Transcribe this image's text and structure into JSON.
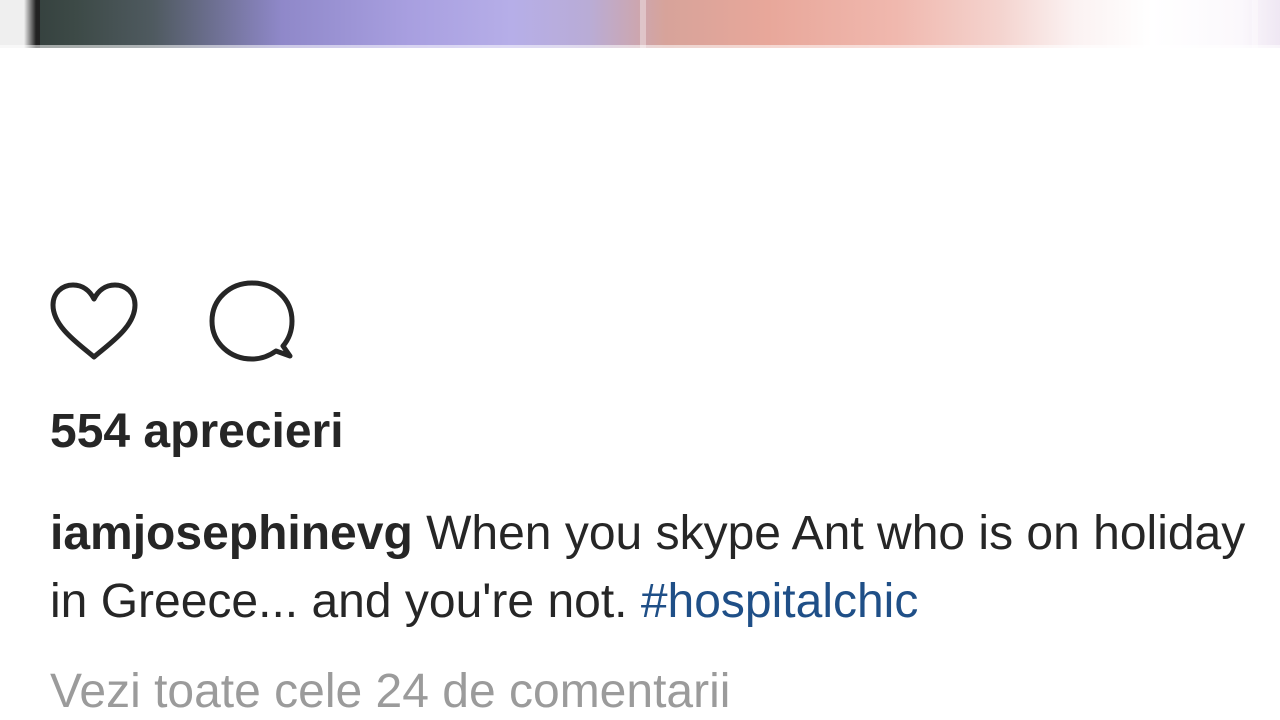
{
  "post": {
    "likes_text": "554 aprecieri",
    "caption": {
      "username": "iamjosephinevg",
      "text": "When you skype Ant who is on holiday in Greece... and you're not.",
      "hashtag": "#hospitalchic"
    },
    "view_comments_text": "Vezi toate cele 24 de comentarii"
  },
  "icons": {
    "like": "heart-outline-icon",
    "comment": "speech-bubble-icon"
  },
  "colors": {
    "text": "#262626",
    "hashtag": "#1f4f87",
    "muted": "#9b9b9b",
    "background": "#ffffff"
  }
}
